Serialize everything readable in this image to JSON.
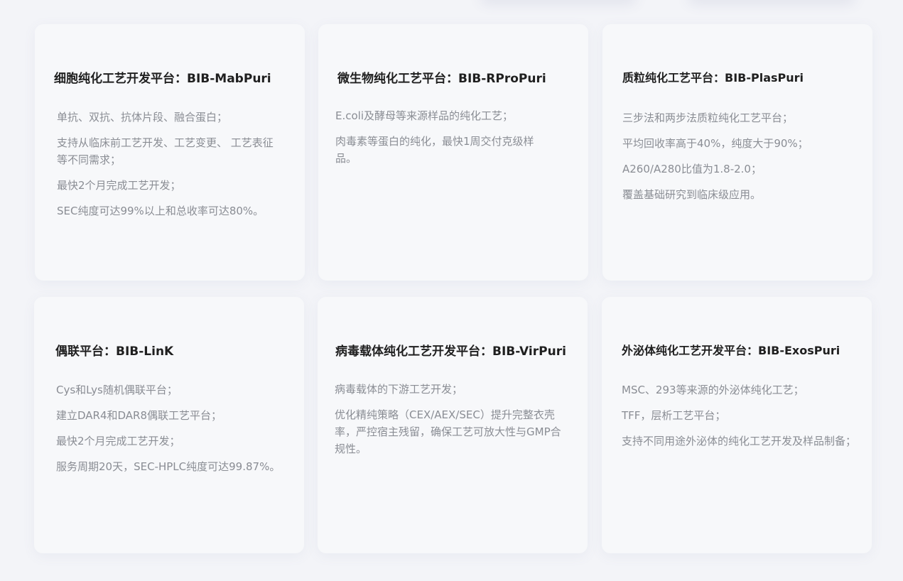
{
  "cards": [
    {
      "title": "细胞纯化工艺开发平台：BIB-MabPuri",
      "items": [
        "单抗、双抗、抗体片段、融合蛋白；",
        "支持从临床前工艺开发、工艺变更、 工艺表征等不同需求；",
        "最快2个月完成工艺开发；",
        "SEC纯度可达99%以上和总收率可达80%。"
      ]
    },
    {
      "title": "微生物纯化工艺平台：BIB-RProPuri",
      "items": [
        "E.coli及酵母等来源样品的纯化工艺；",
        "肉毒素等蛋白的纯化，最快1周交付克级样品。"
      ]
    },
    {
      "title": "质粒纯化工艺平台：BIB-PlasPuri",
      "items": [
        "三步法和两步法质粒纯化工艺平台；",
        "平均回收率高于40%，纯度大于90%；",
        "A260/A280比值为1.8-2.0；",
        "覆盖基础研究到临床级应用。"
      ]
    },
    {
      "title": "偶联平台：BIB-LinK",
      "items": [
        "Cys和Lys随机偶联平台；",
        "建立DAR4和DAR8偶联工艺平台；",
        "最快2个月完成工艺开发；",
        "服务周期20天，SEC-HPLC纯度可达99.87%。"
      ]
    },
    {
      "title": "病毒载体纯化工艺开发平台：BIB-VirPuri",
      "items": [
        "病毒载体的下游工艺开发；",
        "优化精纯策略（CEX/AEX/SEC）提升完整衣壳率，严控宿主残留，确保工艺可放大性与GMP合规性。"
      ]
    },
    {
      "title": "外泌体纯化工艺开发平台：BIB-ExosPuri",
      "items": [
        "MSC、293等来源的外泌体纯化工艺；",
        "TFF，层析工艺平台；",
        "支持不同用途外泌体的纯化工艺开发及样品制备；"
      ]
    }
  ],
  "colors": {
    "background": "#f3f4f8",
    "card": "#f7f8fa",
    "title": "#1f1f1f",
    "text": "#8a8d94"
  }
}
